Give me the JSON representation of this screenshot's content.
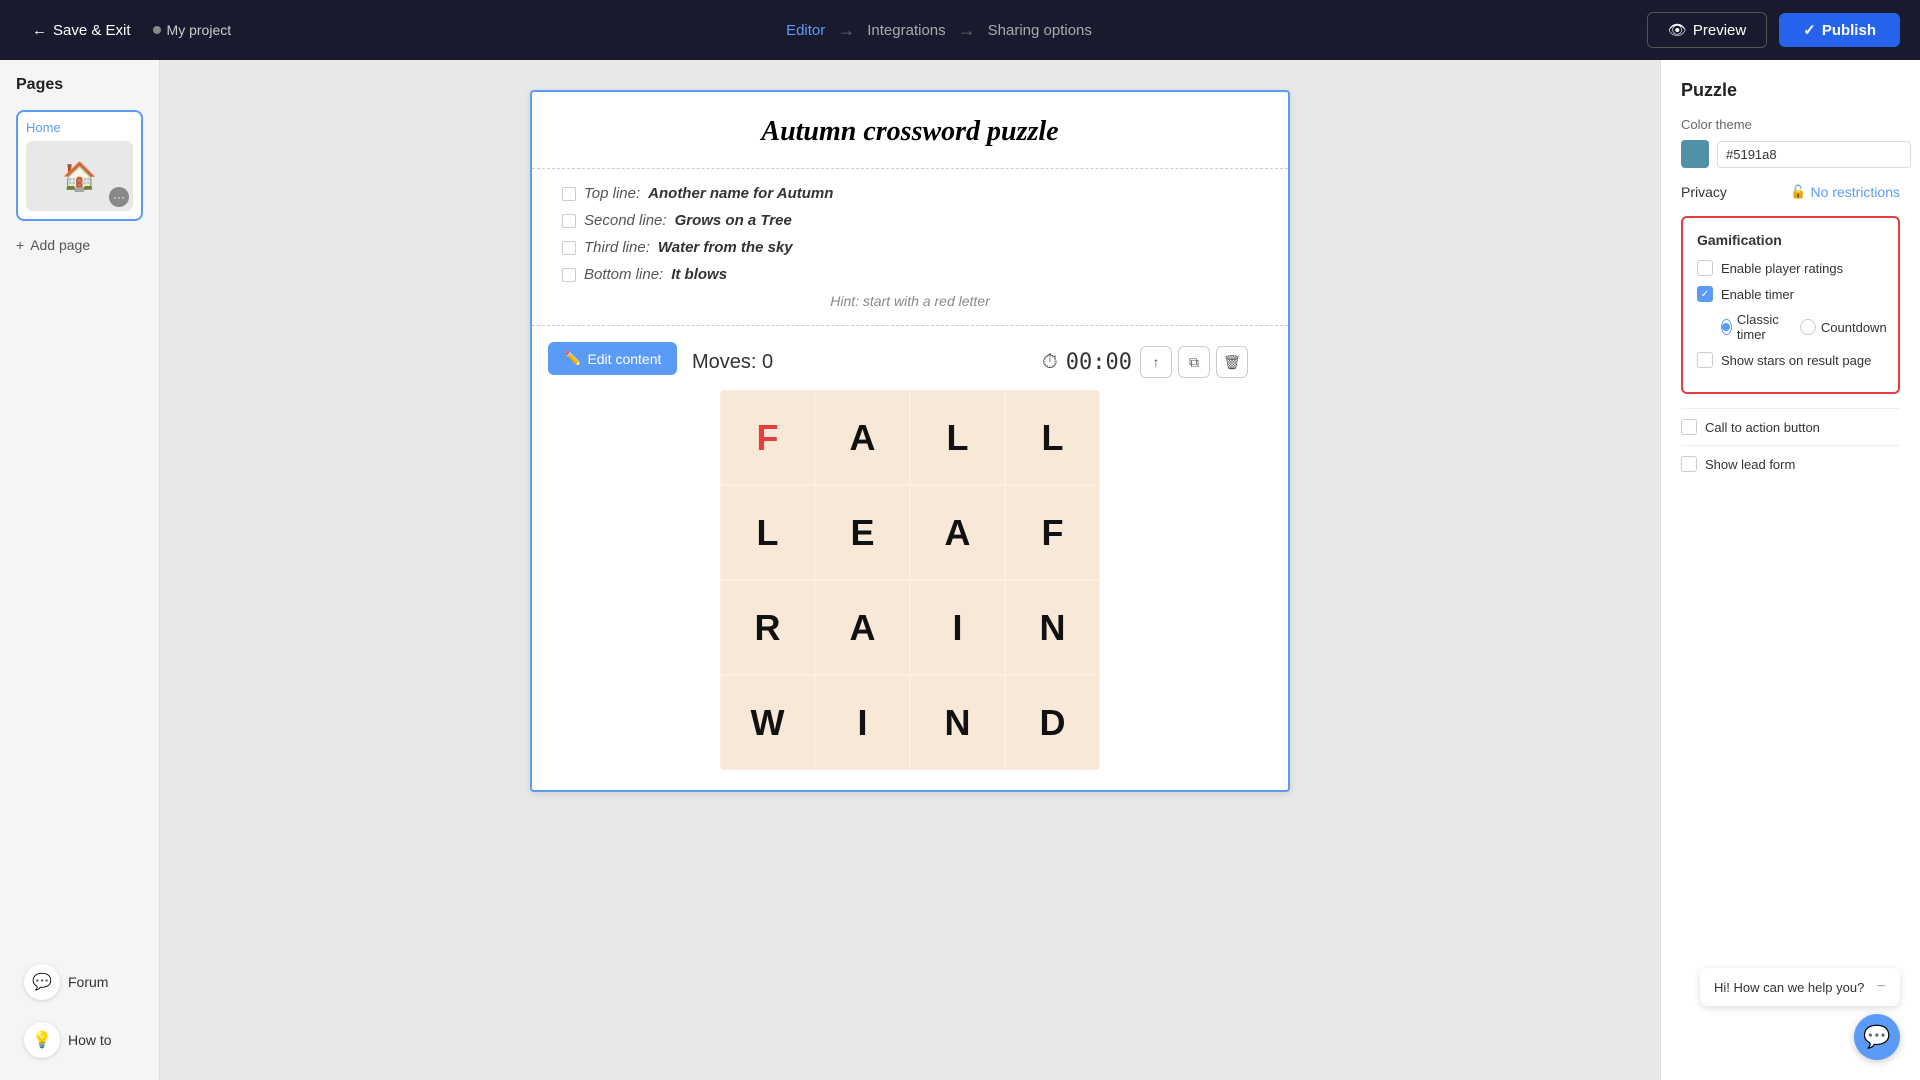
{
  "topbar": {
    "save_exit_label": "Save & Exit",
    "project_name": "My project",
    "nav_editor": "Editor",
    "nav_integrations": "Integrations",
    "nav_sharing": "Sharing options",
    "preview_label": "Preview",
    "publish_label": "Publish"
  },
  "pages_sidebar": {
    "title": "Pages",
    "home_page_label": "Home",
    "add_page_label": "Add page"
  },
  "bottom_sidebar": {
    "forum_label": "Forum",
    "howto_label": "How to"
  },
  "puzzle": {
    "title": "Autumn crossword puzzle",
    "clues": [
      {
        "prefix": "Top line:",
        "answer": "Another name for Autumn"
      },
      {
        "prefix": "Second line:",
        "answer": "Grows on a Tree"
      },
      {
        "prefix": "Third line:",
        "answer": "Water from the sky"
      },
      {
        "prefix": "Bottom line:",
        "answer": "It blows"
      }
    ],
    "hint": "Hint: start with a red letter",
    "edit_btn": "Edit content",
    "moves_label": "Moves:",
    "moves_value": "0",
    "timer_display": "00:00",
    "grid": [
      [
        "F",
        "A",
        "L",
        "L"
      ],
      [
        "L",
        "E",
        "A",
        "F"
      ],
      [
        "R",
        "A",
        "I",
        "N"
      ],
      [
        "W",
        "I",
        "N",
        "D"
      ]
    ],
    "red_cell": {
      "row": 0,
      "col": 0
    }
  },
  "right_panel": {
    "title": "Puzzle",
    "color_theme_label": "Color theme",
    "color_value": "#5191a8",
    "privacy_label": "Privacy",
    "privacy_value": "No restrictions",
    "gamification": {
      "title": "Gamification",
      "enable_player_ratings_label": "Enable player ratings",
      "enable_player_ratings_checked": false,
      "enable_timer_label": "Enable timer",
      "enable_timer_checked": true,
      "timer_type_classic": "Classic timer",
      "timer_type_countdown": "Countdown",
      "selected_timer": "classic",
      "show_stars_label": "Show stars on result page",
      "show_stars_checked": false
    },
    "call_to_action_label": "Call to action button",
    "show_lead_form_label": "Show lead form"
  },
  "chat": {
    "bubble_text": "Hi! How can we help you?"
  }
}
